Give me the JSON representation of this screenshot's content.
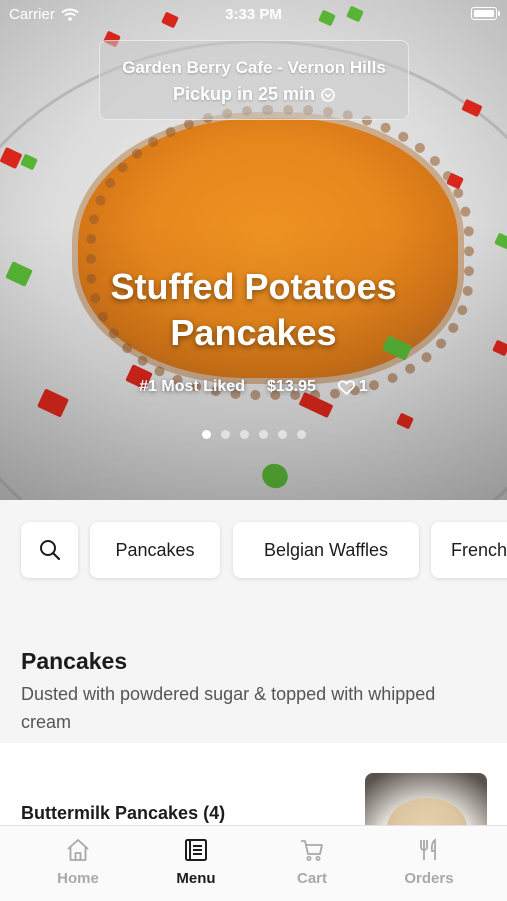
{
  "status_bar": {
    "carrier": "Carrier",
    "time": "3:33 PM"
  },
  "store": {
    "name": "Garden Berry Cafe - Vernon Hills",
    "pickup": "Pickup in 25 min"
  },
  "hero": {
    "title_line1": "Stuffed Potatoes",
    "title_line2": "Pancakes",
    "badge": "#1 Most Liked",
    "price": "$13.95",
    "likes": "1",
    "page_count": 6,
    "active_page": 1
  },
  "categories": {
    "items": [
      "Pancakes",
      "Belgian Waffles",
      "French"
    ]
  },
  "section": {
    "title": "Pancakes",
    "description": "Dusted with powdered sugar & topped with whipped cream"
  },
  "item": {
    "name": "Buttermilk Pancakes (4)"
  },
  "tabs": [
    {
      "label": "Home",
      "icon": "home-icon",
      "active": false
    },
    {
      "label": "Menu",
      "icon": "menu-book-icon",
      "active": true
    },
    {
      "label": "Cart",
      "icon": "cart-icon",
      "active": false
    },
    {
      "label": "Orders",
      "icon": "fork-knife-icon",
      "active": false
    }
  ],
  "colors": {
    "accent": "#1c1c1c",
    "inactive_tab": "#a9a9a9",
    "background": "#f5f5f5"
  }
}
